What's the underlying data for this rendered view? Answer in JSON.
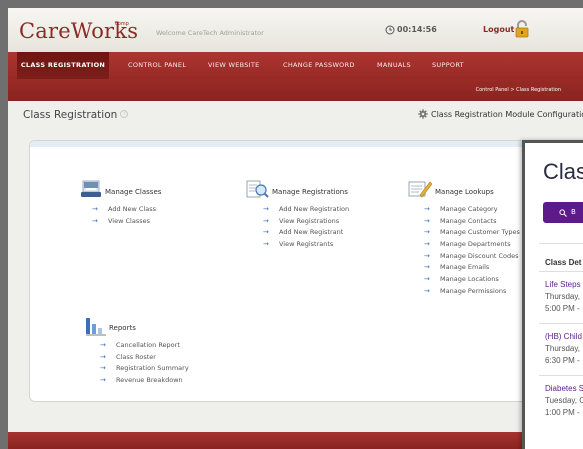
{
  "header": {
    "logo": "CareWorks",
    "logo_tm": "comp",
    "welcome": "Welcome CareTech Administrator",
    "timer": "00:14:56",
    "logout": "Logout"
  },
  "nav": {
    "items": [
      {
        "label": "CLASS REGISTRATION",
        "active": true
      },
      {
        "label": "CONTROL PANEL"
      },
      {
        "label": "VIEW WEBSITE"
      },
      {
        "label": "CHANGE PASSWORD"
      },
      {
        "label": "MANUALS"
      },
      {
        "label": "SUPPORT"
      }
    ],
    "breadcrumb": "Control Panel  >  Class Registration"
  },
  "page": {
    "title": "Class Registration",
    "help": "?",
    "config_link": "Class Registration Module Configuration"
  },
  "groups": {
    "classes": {
      "title": "Manage Classes",
      "items": [
        "Add New Class",
        "View Classes"
      ]
    },
    "registrations": {
      "title": "Manage Registrations",
      "items": [
        "Add New Registration",
        "View Registrations",
        "Add New Registrant",
        "View Registrants"
      ]
    },
    "lookups": {
      "title": "Manage Lookups",
      "items": [
        "Manage Category",
        "Manage Contacts",
        "Manage Customer Types",
        "Manage Departments",
        "Manage Discount Codes",
        "Manage Emails",
        "Manage Locations",
        "Manage Permissions"
      ]
    },
    "reports": {
      "title": "Reports",
      "items": [
        "Cancellation Report",
        "Class Roster",
        "Registration Summary",
        "Revenue Breakdown"
      ]
    }
  },
  "overlay": {
    "title": "Class",
    "button": "B",
    "section": "Class Det",
    "cards": [
      {
        "name": "Life Steps",
        "day": "Thursday,",
        "time": "5:00 PM -"
      },
      {
        "name": "(HB) Child",
        "day": "Thursday,",
        "time": "6:30 PM -"
      },
      {
        "name": "Diabetes S",
        "day": "Tuesday, C",
        "time": "1:00 PM -"
      }
    ]
  },
  "colors": {
    "brand": "#8c2a25",
    "nav_bg": "#a1302b",
    "link_arrow": "#3f72b7",
    "overlay_accent": "#5d1a8b"
  }
}
